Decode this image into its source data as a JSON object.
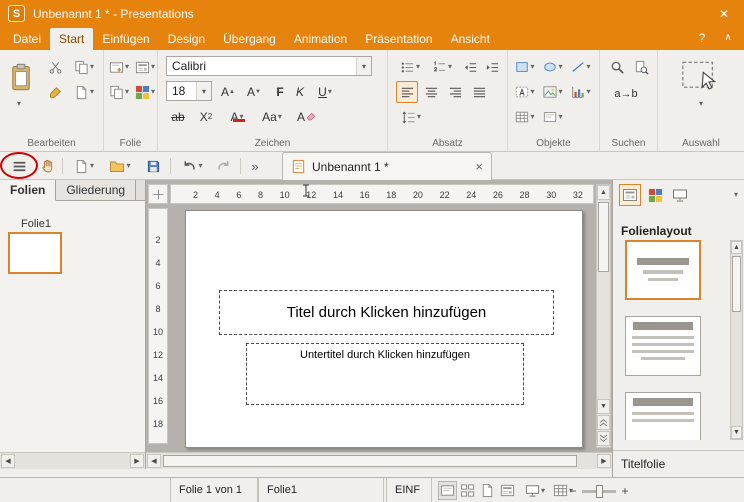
{
  "titlebar": {
    "app_initial": "S",
    "title": "Unbenannt 1 * - Presentations"
  },
  "glyphs": {
    "dropdown": "▾",
    "close": "✕",
    "tab_close": "×",
    "overflow": "»",
    "up": "▲",
    "down": "▼",
    "left": "◀",
    "right": "▶",
    "minus": "−",
    "plus": "+",
    "help": "?",
    "collapse": "∧"
  },
  "menu": {
    "tabs": [
      {
        "label": "Datei"
      },
      {
        "label": "Start"
      },
      {
        "label": "Einfügen"
      },
      {
        "label": "Design"
      },
      {
        "label": "Übergang"
      },
      {
        "label": "Animation"
      },
      {
        "label": "Präsentation"
      },
      {
        "label": "Ansicht"
      }
    ]
  },
  "ribbon": {
    "group_labels": {
      "bearbeiten": "Bearbeiten",
      "folie": "Folie",
      "zeichen": "Zeichen",
      "absatz": "Absatz",
      "objekte": "Objekte",
      "suchen": "Suchen",
      "auswahl": "Auswahl"
    },
    "zeichen": {
      "font_name": "Calibri",
      "font_size": "18",
      "grow_label": "A",
      "shrink_label": "A",
      "bold_label": "F",
      "italic_label": "K",
      "underline_label": "U",
      "strike_label": "ab",
      "subscript_label": "X",
      "subscript_sub": "2",
      "font_color_label": "A",
      "case_label": "Aa",
      "clear_label": "A"
    },
    "suchen": {
      "replace_label": "a→b"
    }
  },
  "toolbar": {
    "doc_tab": {
      "title": "Unbenannt 1 *"
    }
  },
  "left_panel": {
    "tab_folien": "Folien",
    "tab_gliederung": "Gliederung",
    "slide_caption": "Folie1"
  },
  "canvas": {
    "h_ruler": [
      "2",
      "4",
      "6",
      "8",
      "10",
      "12",
      "14",
      "16",
      "18",
      "20",
      "22",
      "24",
      "26",
      "28",
      "30",
      "32"
    ],
    "v_ruler": [
      "2",
      "4",
      "6",
      "8",
      "10",
      "12",
      "14",
      "16",
      "18"
    ],
    "title_placeholder": "Titel durch Klicken hinzufügen",
    "subtitle_placeholder": "Untertitel durch Klicken hinzufügen"
  },
  "right_panel": {
    "heading": "Folienlayout",
    "selected_layout_name": "Titelfolie"
  },
  "statusbar": {
    "slide_info": "Folie 1 von 1",
    "slide_name": "Folie1",
    "insert_mode": "EINF"
  },
  "colors": {
    "titlebar_orange": "#E6830D",
    "accent_orange": "#D8842C",
    "annotation_red": "#D40000"
  }
}
